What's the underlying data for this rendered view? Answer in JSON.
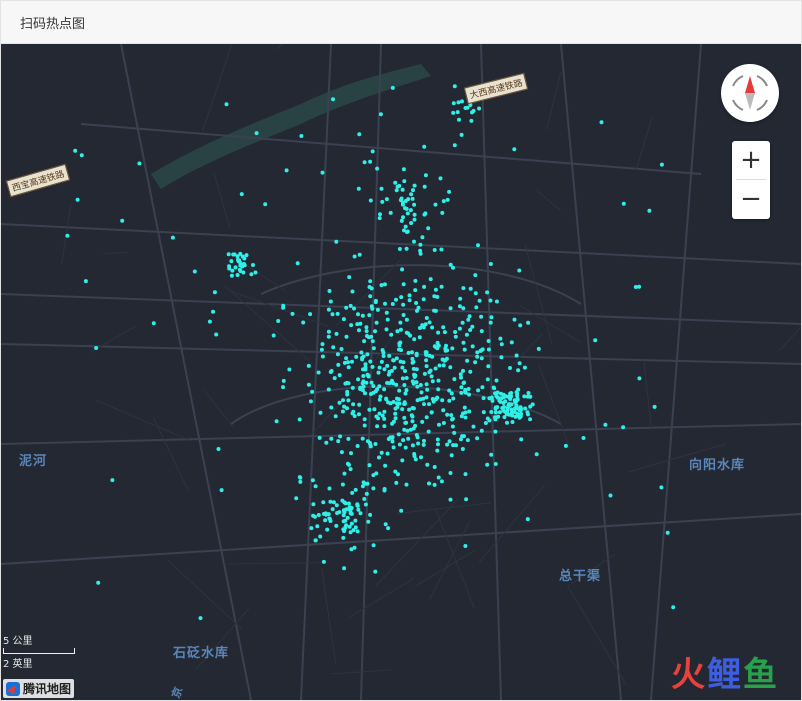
{
  "header": {
    "title": "扫码热点图"
  },
  "map": {
    "labels": {
      "nihe": "泥河",
      "xiangyang": "向阳水库",
      "zonggan": "总干渠",
      "shibian": "石砭水库",
      "railway_daxi": "大西高速铁路",
      "railway_xibao": "西宝高速铁路",
      "road_bottom": "京"
    },
    "scale": {
      "metric": "5 公里",
      "imperial": "2 英里"
    },
    "logo": "腾讯地图",
    "zoom_in": "+",
    "zoom_out": "−",
    "colors": {
      "background": "#232833",
      "heat_point": "#2ef0e8",
      "water": "#2b4a4a",
      "road": "#3a4150"
    },
    "icons": {
      "compass": "compass-icon",
      "logo": "tencent-map-logo-icon"
    }
  },
  "watermark": {
    "c1": "火",
    "c2": "鲤",
    "c3": "鱼"
  }
}
